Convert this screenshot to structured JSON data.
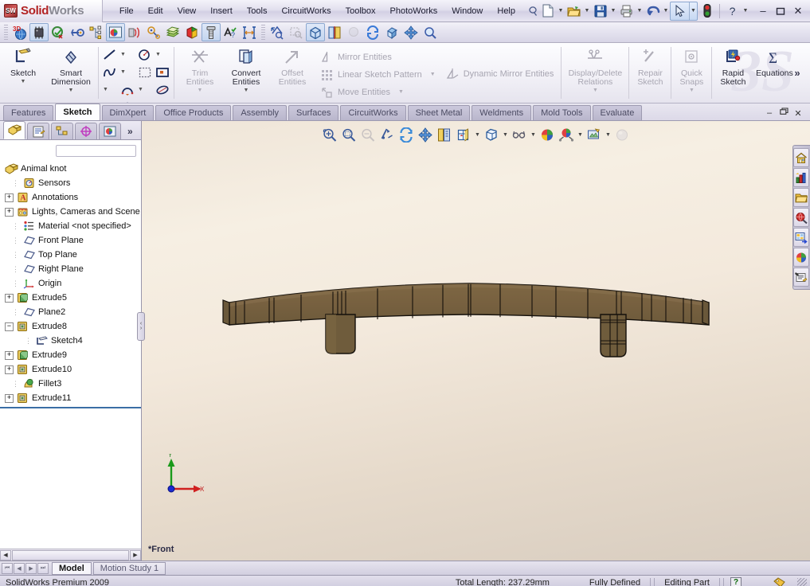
{
  "app": {
    "name_solid": "Solid",
    "name_works": "Works",
    "logo_text": "SW"
  },
  "menu": {
    "items": [
      {
        "label": "File"
      },
      {
        "label": "Edit"
      },
      {
        "label": "View"
      },
      {
        "label": "Insert"
      },
      {
        "label": "Tools"
      },
      {
        "label": "CircuitWorks"
      },
      {
        "label": "Toolbox"
      },
      {
        "label": "PhotoWorks"
      },
      {
        "label": "Window"
      },
      {
        "label": "Help"
      }
    ],
    "pin_icon": "pushpin-icon"
  },
  "quick_access": {
    "buttons": [
      {
        "name": "new-document",
        "icon": "new-doc-icon",
        "has_arrow": true
      },
      {
        "name": "open-document",
        "icon": "open-folder-icon",
        "has_arrow": true
      },
      {
        "name": "save-document",
        "icon": "save-disk-icon",
        "has_arrow": true
      },
      {
        "name": "print-document",
        "icon": "printer-icon",
        "has_arrow": true
      },
      {
        "name": "undo",
        "icon": "undo-arrow-icon",
        "has_arrow": true
      },
      {
        "name": "select",
        "icon": "cursor-arrow-icon",
        "has_arrow": true,
        "selected": true
      },
      {
        "name": "rebuild",
        "icon": "traffic-light-icon",
        "has_arrow": false
      },
      {
        "name": "help",
        "icon": "question-mark-icon",
        "has_arrow": true
      }
    ],
    "window_controls": [
      {
        "name": "minimize-window",
        "glyph": "–"
      },
      {
        "name": "restore-window",
        "glyph": "❐"
      },
      {
        "name": "close-window",
        "glyph": "✕"
      }
    ]
  },
  "icon_toolbar": {
    "group1": [
      {
        "name": "3d-content-central-icon"
      },
      {
        "name": "circuitworks-component-icon",
        "pressed": true
      },
      {
        "name": "check-sketch-icon"
      },
      {
        "name": "route-point-icon"
      },
      {
        "name": "photoworks-render-icon",
        "pressed": true
      },
      {
        "name": "simulation-icon"
      },
      {
        "name": "motion-study-icon"
      },
      {
        "name": "drawing-layers-icon"
      },
      {
        "name": "appearance-cube-icon"
      },
      {
        "name": "toolbox-fastener-icon",
        "pressed": true
      },
      {
        "name": "design-checker-icon"
      },
      {
        "name": "measure-icon"
      }
    ],
    "group2": [
      {
        "name": "zoom-to-fit-icon"
      },
      {
        "name": "zoom-area-icon",
        "disabled": true
      },
      {
        "name": "view-orientation-box-icon",
        "pressed": true
      },
      {
        "name": "section-view-icon"
      },
      {
        "name": "shadows-icon",
        "disabled": true
      },
      {
        "name": "rotate-view-icon"
      },
      {
        "name": "isometric-view-icon"
      },
      {
        "name": "pan-view-icon"
      },
      {
        "name": "magnifier-icon"
      }
    ]
  },
  "ribbon": {
    "watermark": "3S",
    "overflow_glyph": "»",
    "big_buttons": [
      {
        "name": "sketch-button",
        "label": "Sketch",
        "icon": "sketch-pencil-icon",
        "dropdown": true,
        "disabled": false
      },
      {
        "name": "smart-dimension-button",
        "label": "Smart\nDimension",
        "icon": "smart-dimension-icon",
        "dropdown": true,
        "disabled": false
      },
      {
        "name": "trim-entities-button",
        "label": "Trim\nEntities",
        "icon": "trim-scissors-icon",
        "dropdown": true,
        "disabled": true
      },
      {
        "name": "convert-entities-button",
        "label": "Convert\nEntities",
        "icon": "convert-entities-icon",
        "dropdown": true,
        "disabled": false
      },
      {
        "name": "offset-entities-button",
        "label": "Offset\nEntities",
        "icon": "offset-arrow-icon",
        "dropdown": false,
        "disabled": true
      },
      {
        "name": "display-delete-relations-button",
        "label": "Display/Delete\nRelations",
        "icon": "relations-icon",
        "dropdown": true,
        "disabled": true
      },
      {
        "name": "repair-sketch-button",
        "label": "Repair\nSketch",
        "icon": "repair-pencil-icon",
        "dropdown": false,
        "disabled": true
      },
      {
        "name": "quick-snaps-button",
        "label": "Quick\nSnaps",
        "icon": "quick-snap-icon",
        "dropdown": true,
        "disabled": true
      },
      {
        "name": "rapid-sketch-button",
        "label": "Rapid\nSketch",
        "icon": "rapid-sketch-icon",
        "dropdown": false,
        "disabled": false
      },
      {
        "name": "equations-button",
        "label": "Equations",
        "icon": "sigma-icon",
        "dropdown": false,
        "disabled": false
      }
    ],
    "sketch_tools_grid": [
      {
        "name": "line-tool",
        "icon": "line-icon",
        "arrow": true
      },
      {
        "name": "circle-tool",
        "icon": "circle-icon",
        "arrow": true
      },
      {
        "name": "spline-tool",
        "icon": "spline-icon",
        "arrow": true
      },
      {
        "name": "sketch-fillet-tool",
        "icon": "dashed-rect-icon",
        "arrow": false
      },
      {
        "name": "rectangle-tool",
        "icon": "rectangle-icon",
        "arrow": true
      },
      {
        "name": "arc-tool",
        "icon": "arc-icon",
        "arrow": true
      },
      {
        "name": "ellipse-tool",
        "icon": "ellipse-icon",
        "arrow": true
      },
      {
        "name": "text-tool",
        "icon": "text-a-icon",
        "arrow": false
      },
      {
        "name": "slot-tool",
        "icon": "slot-icon",
        "arrow": true
      },
      {
        "name": "polygon-tool",
        "icon": "polygon-icon",
        "arrow": false
      },
      {
        "name": "fillet-tool",
        "icon": "corner-fillet-icon",
        "arrow": true,
        "disabled": true
      },
      {
        "name": "point-tool",
        "icon": "point-star-icon",
        "arrow": false
      }
    ],
    "text_tools": [
      {
        "name": "mirror-entities-item",
        "label": "Mirror Entities",
        "icon": "mirror-icon",
        "disabled": true
      },
      {
        "name": "linear-sketch-pattern-item",
        "label": "Linear Sketch Pattern",
        "icon": "pattern-grid-icon",
        "disabled": true,
        "arrow": true
      },
      {
        "name": "move-entities-item",
        "label": "Move Entities",
        "icon": "move-entities-icon",
        "disabled": true,
        "arrow": true
      },
      {
        "name": "dynamic-mirror-entities-item",
        "label": "Dynamic Mirror Entities",
        "icon": "dynamic-mirror-icon",
        "disabled": true
      }
    ]
  },
  "tabs": {
    "items": [
      {
        "label": "Features",
        "active": false
      },
      {
        "label": "Sketch",
        "active": true
      },
      {
        "label": "DimXpert",
        "active": false
      },
      {
        "label": "Office Products",
        "active": false
      },
      {
        "label": "Assembly",
        "active": false
      },
      {
        "label": "Surfaces",
        "active": false
      },
      {
        "label": "CircuitWorks",
        "active": false
      },
      {
        "label": "Sheet Metal",
        "active": false
      },
      {
        "label": "Weldments",
        "active": false
      },
      {
        "label": "Mold Tools",
        "active": false
      },
      {
        "label": "Evaluate",
        "active": false
      }
    ],
    "window_controls": [
      {
        "name": "minimize-doc",
        "glyph": "–"
      },
      {
        "name": "restore-doc",
        "glyph": "❐"
      },
      {
        "name": "close-doc",
        "glyph": "✕"
      }
    ]
  },
  "feature_manager": {
    "tabs": [
      {
        "name": "feature-manager-tab",
        "icon": "feature-tree-icon",
        "active": true
      },
      {
        "name": "property-manager-tab",
        "icon": "property-clipboard-icon",
        "active": false
      },
      {
        "name": "configuration-manager-tab",
        "icon": "configuration-icon",
        "active": false
      },
      {
        "name": "dimxpert-manager-tab",
        "icon": "dimxpert-target-icon",
        "active": false
      },
      {
        "name": "display-manager-tab",
        "icon": "display-appearance-icon",
        "active": false
      }
    ],
    "more_glyph": "»",
    "search_value": "",
    "tree": [
      {
        "label": "Animal knot",
        "icon": "part-icon",
        "indent": 0,
        "expander": "none",
        "root": true
      },
      {
        "label": "Sensors",
        "icon": "sensors-icon",
        "indent": 1,
        "expander": "none"
      },
      {
        "label": "Annotations",
        "icon": "annotations-icon",
        "indent": 1,
        "expander": "plus"
      },
      {
        "label": "Lights, Cameras and Scene",
        "icon": "lights-cameras-icon",
        "indent": 1,
        "expander": "plus"
      },
      {
        "label": "Material <not specified>",
        "icon": "material-icon",
        "indent": 1,
        "expander": "none"
      },
      {
        "label": "Front Plane",
        "icon": "plane-icon",
        "indent": 1,
        "expander": "none"
      },
      {
        "label": "Top Plane",
        "icon": "plane-icon",
        "indent": 1,
        "expander": "none"
      },
      {
        "label": "Right Plane",
        "icon": "plane-icon",
        "indent": 1,
        "expander": "none"
      },
      {
        "label": "Origin",
        "icon": "origin-icon",
        "indent": 1,
        "expander": "none"
      },
      {
        "label": "Extrude5",
        "icon": "extrude-boss-icon",
        "indent": 1,
        "expander": "plus"
      },
      {
        "label": "Plane2",
        "icon": "plane-icon",
        "indent": 1,
        "expander": "none"
      },
      {
        "label": "Extrude8",
        "icon": "extrude-cut-icon",
        "indent": 1,
        "expander": "minus"
      },
      {
        "label": "Sketch4",
        "icon": "sketch-icon",
        "indent": 2,
        "expander": "none"
      },
      {
        "label": "Extrude9",
        "icon": "extrude-boss-icon",
        "indent": 1,
        "expander": "plus"
      },
      {
        "label": "Extrude10",
        "icon": "extrude-cut-icon",
        "indent": 1,
        "expander": "plus"
      },
      {
        "label": "Fillet3",
        "icon": "fillet-icon",
        "indent": 1,
        "expander": "none"
      },
      {
        "label": "Extrude11",
        "icon": "extrude-cut-icon",
        "indent": 1,
        "expander": "plus"
      }
    ]
  },
  "viewport": {
    "view_label": "*Front",
    "triad": {
      "x_label": "X",
      "y_label": "Y"
    },
    "heads_up_toolbar": [
      {
        "name": "zoom-to-fit-button",
        "icon": "zoom-fit-icon",
        "arrow": false
      },
      {
        "name": "zoom-to-area-button",
        "icon": "zoom-area-icon",
        "arrow": false
      },
      {
        "name": "previous-view-button",
        "icon": "zoom-previous-icon",
        "arrow": false,
        "disabled": true
      },
      {
        "name": "section-view-button",
        "icon": "section-view-icon",
        "arrow": false
      },
      {
        "name": "rotate-view-button",
        "icon": "rotate-view-icon",
        "arrow": false
      },
      {
        "name": "pan-view-button",
        "icon": "pan-view-icon",
        "arrow": false
      },
      {
        "name": "3d-drawing-view-button",
        "icon": "drawing-view-icon",
        "arrow": false
      },
      {
        "name": "view-orientation-button",
        "icon": "view-orientation-icon",
        "arrow": true
      },
      {
        "name": "display-style-button",
        "icon": "display-style-cube-icon",
        "arrow": true
      },
      {
        "name": "hide-show-items-button",
        "icon": "eyeglasses-icon",
        "arrow": true
      },
      {
        "name": "edit-appearance-button",
        "icon": "appearance-sphere-icon",
        "arrow": false
      },
      {
        "name": "apply-scene-button",
        "icon": "scene-icon",
        "arrow": true
      },
      {
        "name": "view-settings-button",
        "icon": "view-settings-icon",
        "arrow": true
      },
      {
        "name": "realview-graphics-button",
        "icon": "realview-sphere-icon",
        "arrow": false,
        "disabled": true
      }
    ],
    "model": {
      "description": "wooden bar / belt buckle part, front view, shaded with edges",
      "body_color": "#7a6440",
      "edge_color": "#1a1410"
    }
  },
  "task_pane": {
    "buttons": [
      {
        "name": "solidworks-resources-button",
        "icon": "home-icon"
      },
      {
        "name": "design-library-button",
        "icon": "library-chart-icon"
      },
      {
        "name": "file-explorer-button",
        "icon": "folder-icon"
      },
      {
        "name": "search-button",
        "icon": "search-globe-icon"
      },
      {
        "name": "view-palette-button",
        "icon": "view-palette-icon"
      },
      {
        "name": "appearances-scenes-button",
        "icon": "appearance-ball-icon"
      },
      {
        "name": "custom-properties-button",
        "icon": "custom-properties-icon"
      }
    ]
  },
  "bottom_tabs": {
    "nav_buttons": [
      {
        "name": "first-tab-button",
        "glyph": "⏮"
      },
      {
        "name": "prev-tab-button",
        "glyph": "◀"
      },
      {
        "name": "next-tab-button",
        "glyph": "▶"
      },
      {
        "name": "last-tab-button",
        "glyph": "⏭"
      }
    ],
    "items": [
      {
        "label": "Model",
        "active": true
      },
      {
        "label": "Motion Study 1",
        "active": false
      }
    ]
  },
  "status_bar": {
    "edition": "SolidWorks Premium 2009",
    "total_length": "Total Length: 237.29mm",
    "sketch_state": "Fully Defined",
    "edit_mode": "Editing Part",
    "help_glyph": "?",
    "tag_icon": "tag-icon"
  }
}
